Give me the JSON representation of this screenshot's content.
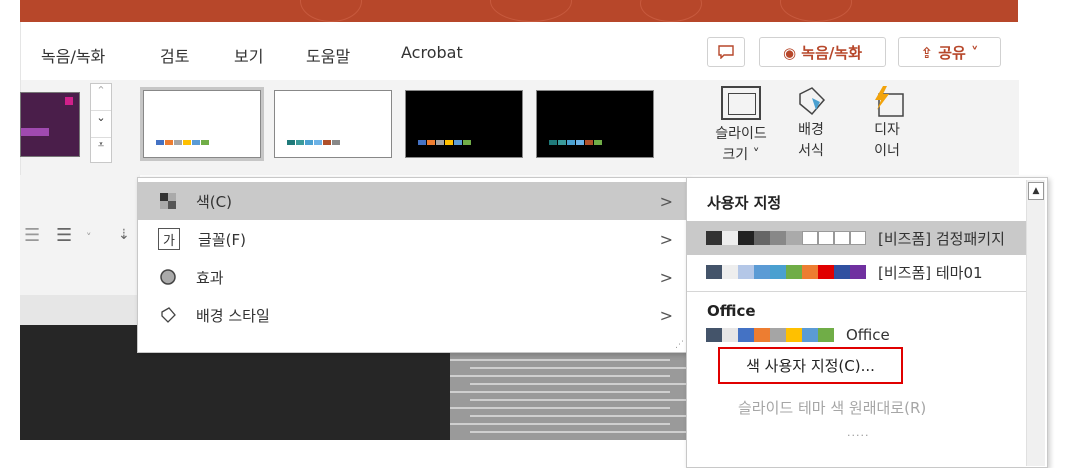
{
  "ribbon": {
    "tabs": [
      "녹음/녹화",
      "검토",
      "보기",
      "도움말",
      "Acrobat"
    ],
    "record_label": "◉ 녹음/녹화",
    "share_label": "⇪ 공유 ˅",
    "comment_icon": "comment-icon",
    "slide_size_label": "슬라이드\n크기 ˅",
    "bg_format_label": "배경\n서식",
    "designer_label": "디자\n이너"
  },
  "theme_variants": [
    {
      "bg": "#ffffff",
      "colors": [
        "#4472c4",
        "#ed7d31",
        "#a5a5a5",
        "#ffc000",
        "#5b9bd5",
        "#70ad47"
      ]
    },
    {
      "bg": "#ffffff",
      "colors": [
        "#1f7a7a",
        "#3a9a9a",
        "#4aa0d0",
        "#6cb2e6",
        "#b0502a",
        "#888888"
      ]
    },
    {
      "bg": "#000000",
      "colors": [
        "#4472c4",
        "#ed7d31",
        "#a5a5a5",
        "#ffc000",
        "#5b9bd5",
        "#70ad47"
      ]
    },
    {
      "bg": "#000000",
      "colors": [
        "#1f7a7a",
        "#3a9a9a",
        "#4aa0d0",
        "#6cb2e6",
        "#b0502a",
        "#70ad47"
      ]
    }
  ],
  "menu": {
    "items": [
      {
        "label": "색(C)",
        "icon": "color-icon"
      },
      {
        "label": "글꼴(F)",
        "icon": "font-icon"
      },
      {
        "label": "효과",
        "icon": "effects-icon"
      },
      {
        "label": "배경 스타일",
        "icon": "background-style-icon"
      }
    ]
  },
  "submenu": {
    "section_custom": "사용자 지정",
    "custom_items": [
      {
        "label": "[비즈폼] 검정패키지",
        "colors": [
          "#333333",
          "#eeeeee",
          "#222222",
          "#666666",
          "#888888",
          "#aaaaaa",
          "#ffffff",
          "#ffffff",
          "#ffffff",
          "#ffffff"
        ]
      },
      {
        "label": "[비즈폼] 테마01",
        "colors": [
          "#44546a",
          "#eeeeee",
          "#b4c7e7",
          "#5b9bd5",
          "#4aa0d0",
          "#70ad47",
          "#ed7d31",
          "#e00000",
          "#3050a0",
          "#7030a0"
        ]
      }
    ],
    "section_office": "Office",
    "office_item": {
      "label": "Office",
      "colors": [
        "#44546a",
        "#e7e6e6",
        "#4472c4",
        "#ed7d31",
        "#a5a5a5",
        "#ffc000",
        "#5b9bd5",
        "#70ad47"
      ]
    },
    "customize_label": "색 사용자 지정(C)...",
    "reset_label": "슬라이드 테마 색 원래대로(R)",
    "more_dots": "....."
  },
  "colors": {
    "accent": "#b7472a",
    "highlight": "#e00000"
  }
}
